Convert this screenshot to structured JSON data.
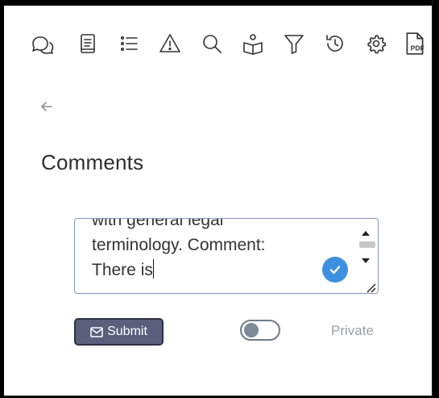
{
  "toolbar": {
    "icons": [
      "comments-icon",
      "document-icon",
      "list-icon",
      "warning-icon",
      "search-icon",
      "reader-icon",
      "filter-icon",
      "history-icon",
      "settings-icon",
      "pdf-icon"
    ],
    "pdf_label": "PDF"
  },
  "page": {
    "title": "Comments"
  },
  "comment_form": {
    "text": "with general legal\nterminology. Comment:\nThere is",
    "submit_label": "Submit",
    "private_toggle_on": false,
    "private_label": "Private"
  },
  "colors": {
    "submit_bg": "#5b5f7c",
    "check_badge": "#3d8fe0",
    "input_border": "#7f9ac3"
  }
}
